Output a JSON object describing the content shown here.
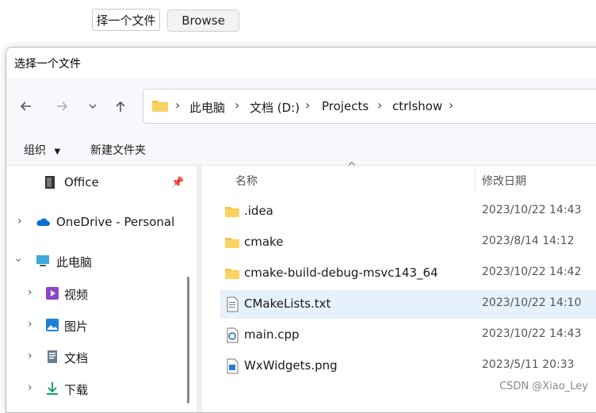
{
  "top": {
    "choose_button": "择一个文件",
    "browse_button": "Browse"
  },
  "dialog": {
    "title": "选择一个文件",
    "address": [
      "此电脑",
      "文档 (D:)",
      "Projects",
      "ctrlshow"
    ],
    "commands": {
      "organize": "组织",
      "new_folder": "新建文件夹"
    }
  },
  "nav": {
    "items": [
      {
        "label": "Office",
        "icon": "office-folder-icon",
        "pinned": true
      },
      {
        "label": "OneDrive - Personal",
        "icon": "cloud-icon"
      },
      {
        "label": "此电脑",
        "icon": "pc-icon"
      },
      {
        "label": "视频",
        "icon": "video-icon"
      },
      {
        "label": "图片",
        "icon": "image-icon"
      },
      {
        "label": "文档",
        "icon": "document-icon"
      },
      {
        "label": "下载",
        "icon": "download-icon"
      }
    ]
  },
  "list": {
    "columns": {
      "name": "名称",
      "date": "修改日期"
    },
    "rows": [
      {
        "name": ".idea",
        "date": "2023/10/22 14:43",
        "type": "folder"
      },
      {
        "name": "cmake",
        "date": "2023/8/14 14:12",
        "type": "folder"
      },
      {
        "name": "cmake-build-debug-msvc143_64",
        "date": "2023/10/22 14:42",
        "type": "folder"
      },
      {
        "name": "CMakeLists.txt",
        "date": "2023/10/22 14:10",
        "type": "text",
        "selected": true
      },
      {
        "name": "main.cpp",
        "date": "2023/10/22 14:43",
        "type": "cpp"
      },
      {
        "name": "WxWidgets.png",
        "date": "2023/5/11 20:33",
        "type": "image"
      }
    ]
  },
  "watermark": "CSDN @Xiao_Ley",
  "colors": {
    "folder": "#f6c445",
    "selected_row": "#e5f1fb",
    "nav_bg": "#f6f8fb",
    "onedrive": "#0a6fd1"
  }
}
